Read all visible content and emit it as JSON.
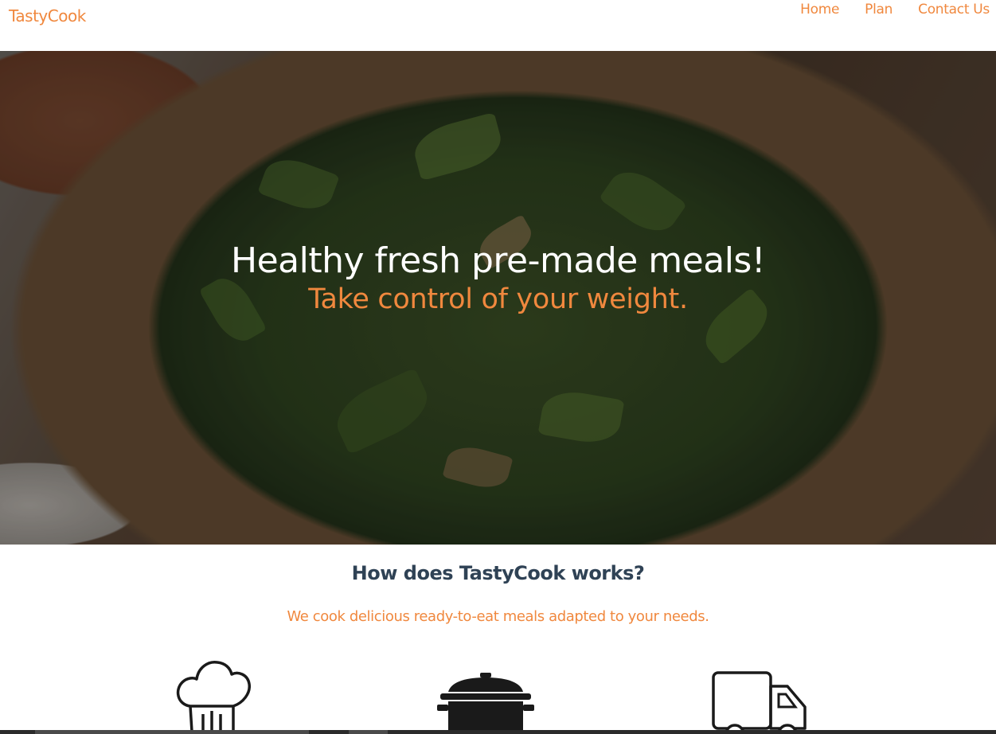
{
  "colors": {
    "accent": "#f0883e",
    "heading": "#2f4255",
    "white": "#ffffff",
    "icon": "#1a1a1a"
  },
  "navbar": {
    "brand": "TastyCook",
    "links": [
      {
        "label": "Home"
      },
      {
        "label": "Plan"
      },
      {
        "label": "Contact Us"
      }
    ]
  },
  "hero": {
    "title": "Healthy fresh pre-made meals!",
    "subtitle": "Take control of your weight."
  },
  "how": {
    "title": "How does TastyCook works?",
    "subtitle": "We cook delicious ready-to-eat meals adapted to your needs.",
    "steps": [
      {
        "icon": "chef-hat-icon"
      },
      {
        "icon": "cooking-pot-icon"
      },
      {
        "icon": "delivery-truck-icon"
      }
    ]
  }
}
